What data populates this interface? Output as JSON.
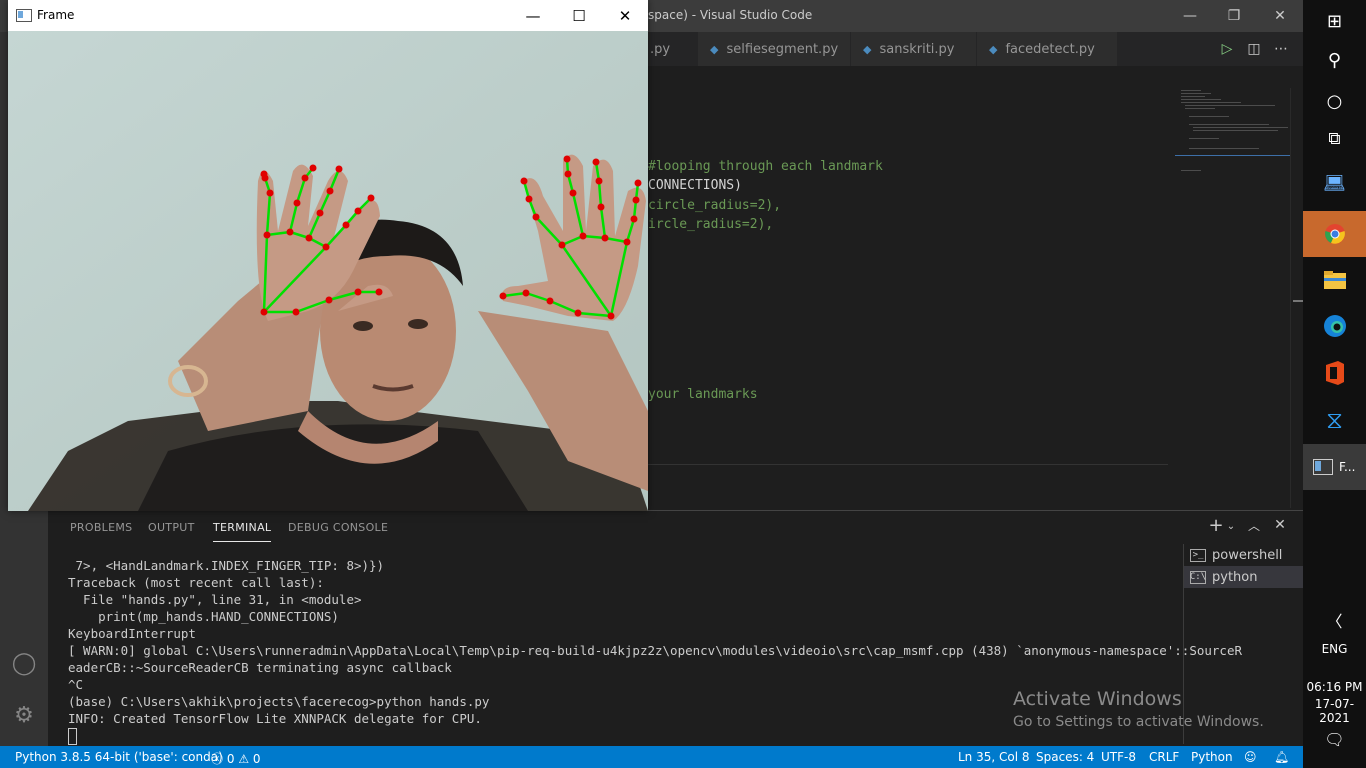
{
  "vscode": {
    "title": "space) - Visual Studio Code",
    "tabs": [
      {
        "label": ".py"
      },
      {
        "label": "selfiesegment.py"
      },
      {
        "label": "sanskriti.py"
      },
      {
        "label": "facedetect.py"
      }
    ],
    "code_lines": [
      {
        "text": "#looping through each landmark",
        "kind": "comment"
      },
      {
        "text": "CONNECTIONS)",
        "kind": "code"
      },
      {
        "text": "circle_radius=2),",
        "kind": "comment"
      },
      {
        "text": "ircle_radius=2),",
        "kind": "comment"
      },
      {
        "text": "your landmarks",
        "kind": "comment"
      }
    ],
    "panel": {
      "tabs": [
        "PROBLEMS",
        "OUTPUT",
        "TERMINAL",
        "DEBUG CONSOLE"
      ],
      "active_tab": "TERMINAL",
      "terminal_lines": [
        " 7>, <HandLandmark.INDEX_FINGER_TIP: 8>)})",
        "Traceback (most recent call last):",
        "  File \"hands.py\", line 31, in <module>",
        "    print(mp_hands.HAND_CONNECTIONS)",
        "KeyboardInterrupt",
        "[ WARN:0] global C:\\Users\\runneradmin\\AppData\\Local\\Temp\\pip-req-build-u4kjpz2z\\opencv\\modules\\videoio\\src\\cap_msmf.cpp (438) `anonymous-namespace'::SourceR",
        "eaderCB::~SourceReaderCB terminating async callback",
        "^C",
        "(base) C:\\Users\\akhik\\projects\\facerecog>python hands.py",
        "INFO: Created TensorFlow Lite XNNPACK delegate for CPU."
      ],
      "terminals": [
        "powershell",
        "python"
      ],
      "active_terminal": "python"
    },
    "activate": {
      "line1": "Activate Windows",
      "line2": "Go to Settings to activate Windows."
    },
    "statusbar": {
      "interpreter": "Python 3.8.5 64-bit ('base': conda)",
      "errors": "0",
      "warnings": "0",
      "position": "Ln 35, Col 8",
      "spaces": "Spaces: 4",
      "encoding": "UTF-8",
      "eol": "CRLF",
      "language": "Python"
    }
  },
  "frame_window": {
    "title": "Frame"
  },
  "taskbar": {
    "app_label": "F...",
    "language": "ENG",
    "time": "06:16 PM",
    "date": "17-07-2021"
  },
  "colors": {
    "statusbar": "#007acc",
    "landmark_point": "#e00000",
    "landmark_connection": "#00e000",
    "comment": "#6a9955"
  }
}
